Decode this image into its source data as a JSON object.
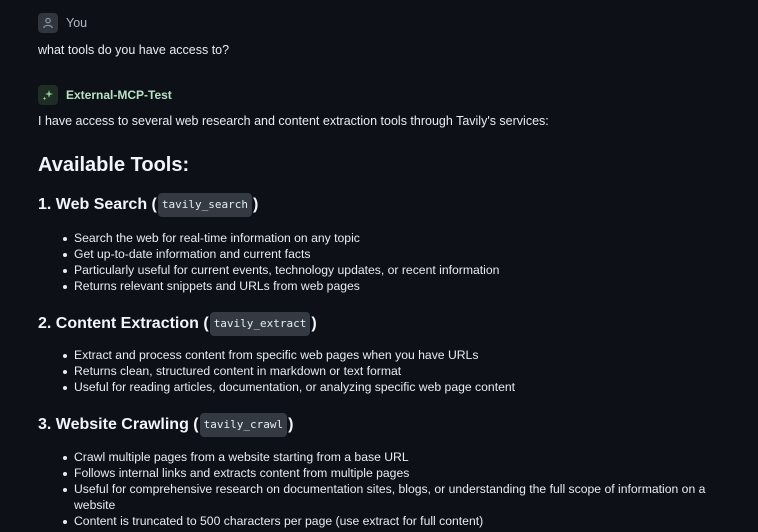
{
  "user_message": {
    "author": "You",
    "avatar_icon": "person-icon",
    "text": "what tools do you have access to?"
  },
  "assistant_message": {
    "author": "External-MCP-Test",
    "avatar_icon": "sparkle-icon",
    "intro": "I have access to several web research and content extraction tools through Tavily's services:",
    "heading": "Available Tools:",
    "tools": [
      {
        "title_prefix": "1. Web Search (",
        "code": "tavily_search",
        "title_suffix": ")",
        "bullets": [
          "Search the web for real-time information on any topic",
          "Get up-to-date information and current facts",
          "Particularly useful for current events, technology updates, or recent information",
          "Returns relevant snippets and URLs from web pages"
        ]
      },
      {
        "title_prefix": "2. Content Extraction (",
        "code": "tavily_extract",
        "title_suffix": ")",
        "bullets": [
          "Extract and process content from specific web pages when you have URLs",
          "Returns clean, structured content in markdown or text format",
          "Useful for reading articles, documentation, or analyzing specific web page content"
        ]
      },
      {
        "title_prefix": "3. Website Crawling (",
        "code": "tavily_crawl",
        "title_suffix": ")",
        "bullets": [
          "Crawl multiple pages from a website starting from a base URL",
          "Follows internal links and extracts content from multiple pages",
          "Useful for comprehensive research on documentation sites, blogs, or understanding the full scope of information on a website",
          "Content is truncated to 500 characters per page (use extract for full content)"
        ]
      }
    ]
  }
}
